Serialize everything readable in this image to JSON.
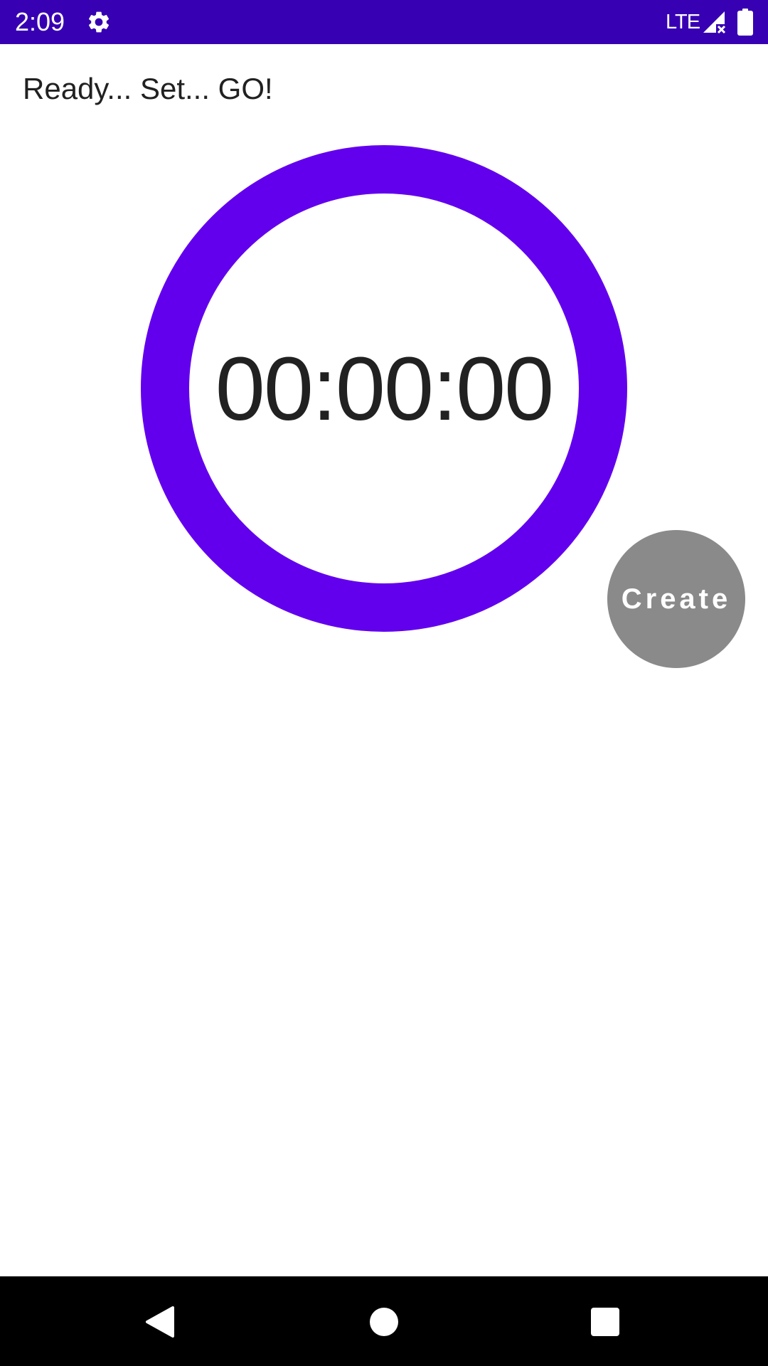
{
  "status_bar": {
    "time": "2:09",
    "network": "LTE",
    "icons": [
      "gear-icon",
      "signal-icon",
      "battery-icon"
    ],
    "background_color": "#3700b3"
  },
  "main": {
    "heading": "Ready... Set... GO!",
    "timer": "00:00:00",
    "ring_color": "#6200ee",
    "create_button_label": "Create",
    "create_button_color": "#8a8a8a"
  },
  "nav_bar": {
    "icons": [
      "back-icon",
      "home-icon",
      "recents-icon"
    ]
  }
}
